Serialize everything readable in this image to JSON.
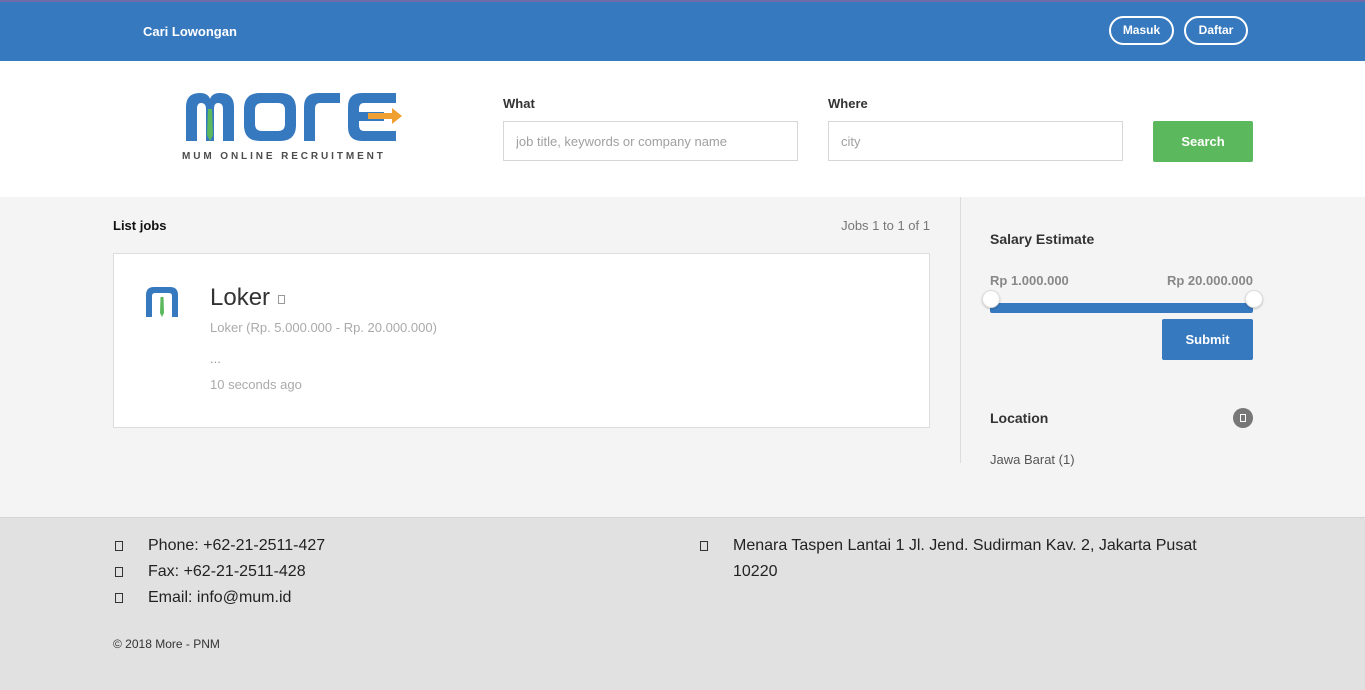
{
  "nav": {
    "link": "Cari Lowongan",
    "login": "Masuk",
    "register": "Daftar"
  },
  "brand": {
    "name": "MORE",
    "tagline": "MUM ONLINE RECRUITMENT",
    "colors": {
      "blue": "#3679bf",
      "green": "#5cb85c",
      "orange": "#f0a030"
    }
  },
  "search": {
    "what_label": "What",
    "what_placeholder": "job title, keywords or company name",
    "where_label": "Where",
    "where_placeholder": "city",
    "button": "Search"
  },
  "list": {
    "title": "List jobs",
    "count": "Jobs 1 to 1 of 1",
    "jobs": [
      {
        "title": "Loker",
        "subtitle": "Loker (Rp. 5.000.000 - Rp. 20.000.000)",
        "description": "...",
        "time": "10 seconds ago"
      }
    ]
  },
  "sidebar": {
    "salary_title": "Salary Estimate",
    "salary_min": "Rp 1.000.000",
    "salary_max": "Rp 20.000.000",
    "submit": "Submit",
    "location_title": "Location",
    "locations": [
      {
        "label": "Jawa Barat (1)"
      }
    ]
  },
  "footer": {
    "phone": "Phone: +62-21-2511-427",
    "fax": "Fax: +62-21-2511-428",
    "email": "Email: info@mum.id",
    "address_line1": "Menara Taspen Lantai 1 Jl. Jend. Sudirman Kav. 2, Jakarta Pusat",
    "address_line2": "10220",
    "copyright": "© 2018 More - PNM"
  }
}
